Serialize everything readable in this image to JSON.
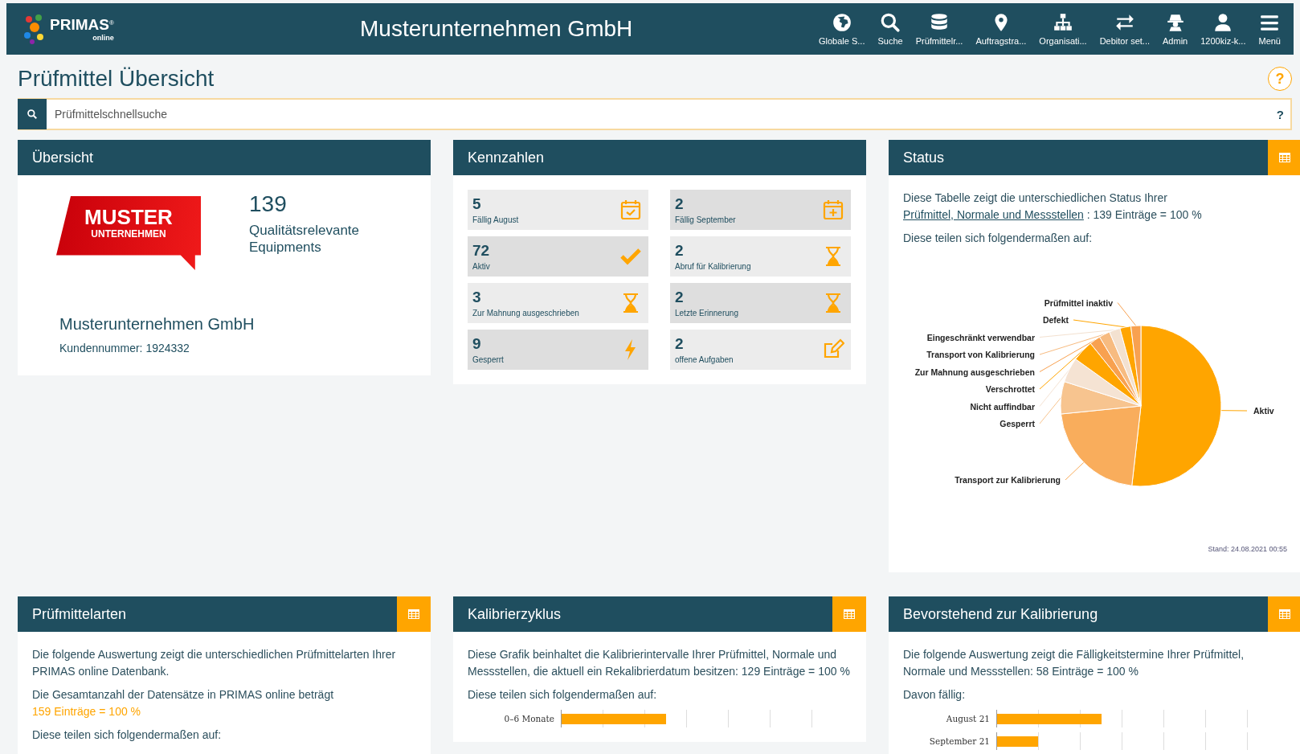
{
  "topbar": {
    "logo": {
      "name": "PRIMAS",
      "mark": "®",
      "sub": "online"
    },
    "title": "Musterunternehmen GmbH",
    "nav": [
      {
        "kind": "globe",
        "label": "Globale S..."
      },
      {
        "kind": "search",
        "label": "Suche"
      },
      {
        "kind": "database",
        "label": "Prüfmittelr..."
      },
      {
        "kind": "pin",
        "label": "Auftragstra..."
      },
      {
        "kind": "sitemap",
        "label": "Organisati..."
      },
      {
        "kind": "exchange",
        "label": "Debitor set..."
      },
      {
        "kind": "agent",
        "label": "Admin"
      },
      {
        "kind": "user",
        "label": "1200kiz-k..."
      },
      {
        "kind": "menu",
        "label": "Menü"
      }
    ]
  },
  "page": {
    "title": "Prüfmittel Übersicht",
    "help": "?"
  },
  "search": {
    "placeholder": "Prüfmittelschnellsuche",
    "help": "?"
  },
  "overview": {
    "title": "Übersicht",
    "logo_lines": [
      "MUSTER",
      "UNTERNEHMEN"
    ],
    "count": "139",
    "count_label": "Qualitätsrelevante Equipments",
    "company": "Musterunternehmen GmbH",
    "customer_no": "Kundennummer: 1924332"
  },
  "kennzahlen": {
    "title": "Kennzahlen",
    "tiles": [
      {
        "value": "5",
        "label": "Fällig August",
        "kind": "calendar-check"
      },
      {
        "value": "2",
        "label": "Fällig September",
        "kind": "calendar-plus"
      },
      {
        "value": "72",
        "label": "Aktiv",
        "kind": "check"
      },
      {
        "value": "2",
        "label": "Abruf für Kalibrierung",
        "kind": "hourglass"
      },
      {
        "value": "3",
        "label": "Zur Mahnung ausgeschrieben",
        "kind": "hourglass"
      },
      {
        "value": "2",
        "label": "Letzte Erinnerung",
        "kind": "hourglass"
      },
      {
        "value": "9",
        "label": "Gesperrt",
        "kind": "bolt"
      },
      {
        "value": "2",
        "label": "offene Aufgaben",
        "kind": "edit"
      }
    ]
  },
  "status": {
    "title": "Status",
    "intro": "Diese Tabelle zeigt die unterschiedlichen Status Ihrer",
    "link": "Prüfmittel, Normale und Messstellen",
    "summary": " : 139 Einträge = 100 %",
    "subtext": "Diese teilen sich folgendermaßen auf:",
    "chart_data": {
      "type": "pie",
      "categories": [
        "Aktiv",
        "Transport zur Kalibrierung",
        "Gesperrt",
        "Nicht auffindbar",
        "Verschrottet",
        "Zur Mahnung ausgeschrieben",
        "Transport von Kalibrierung",
        "Eingeschränkt verwendbar",
        "Defekt",
        "Prüfmittel inaktiv"
      ],
      "values": [
        51.8,
        21.6,
        6.5,
        5.0,
        4.3,
        2.2,
        2.2,
        2.2,
        2.2,
        2.0
      ]
    },
    "footer": "Stand: 24.08.2021 00:55"
  },
  "bottom": [
    {
      "title": "Prüfmittelarten",
      "texts": [
        {
          "kind": "text",
          "text": "Die folgende Auswertung zeigt die unterschiedlichen Prüfmittelarten Ihrer PRIMAS online Datenbank."
        },
        {
          "kind": "text",
          "text": "Die Gesamtanzahl der Datensätze in PRIMAS online beträgt"
        },
        {
          "kind": "highlight",
          "text": "159 Einträge = 100 %"
        },
        {
          "kind": "text",
          "text": "Diese teilen sich folgendermaßen auf:"
        }
      ]
    },
    {
      "title": "Kalibrierzyklus",
      "texts": [
        {
          "kind": "text",
          "text": "Diese Grafik beinhaltet die Kalibrierintervalle Ihrer Prüfmittel, Normale und Messstellen, die aktuell ein Rekalibrierdatum besitzen: 129 Einträge = 100 %"
        },
        {
          "kind": "text",
          "text": "Diese teilen sich folgendermaßen auf:"
        }
      ],
      "bars": [
        {
          "label": "0–6 Monate",
          "level": 0.36
        }
      ]
    },
    {
      "title": "Bevorstehend zur Kalibrierung",
      "texts": [
        {
          "kind": "text",
          "text": "Die folgende Auswertung zeigt die Fälligkeitstermine Ihrer Prüfmittel, Normale und Messstellen: 58 Einträge = 100 %"
        },
        {
          "kind": "text",
          "text": "Davon fällig:"
        }
      ],
      "bars": [
        {
          "label": "August 21",
          "level": 0.36
        },
        {
          "label": "September 21",
          "level": 0.14
        }
      ]
    }
  ]
}
